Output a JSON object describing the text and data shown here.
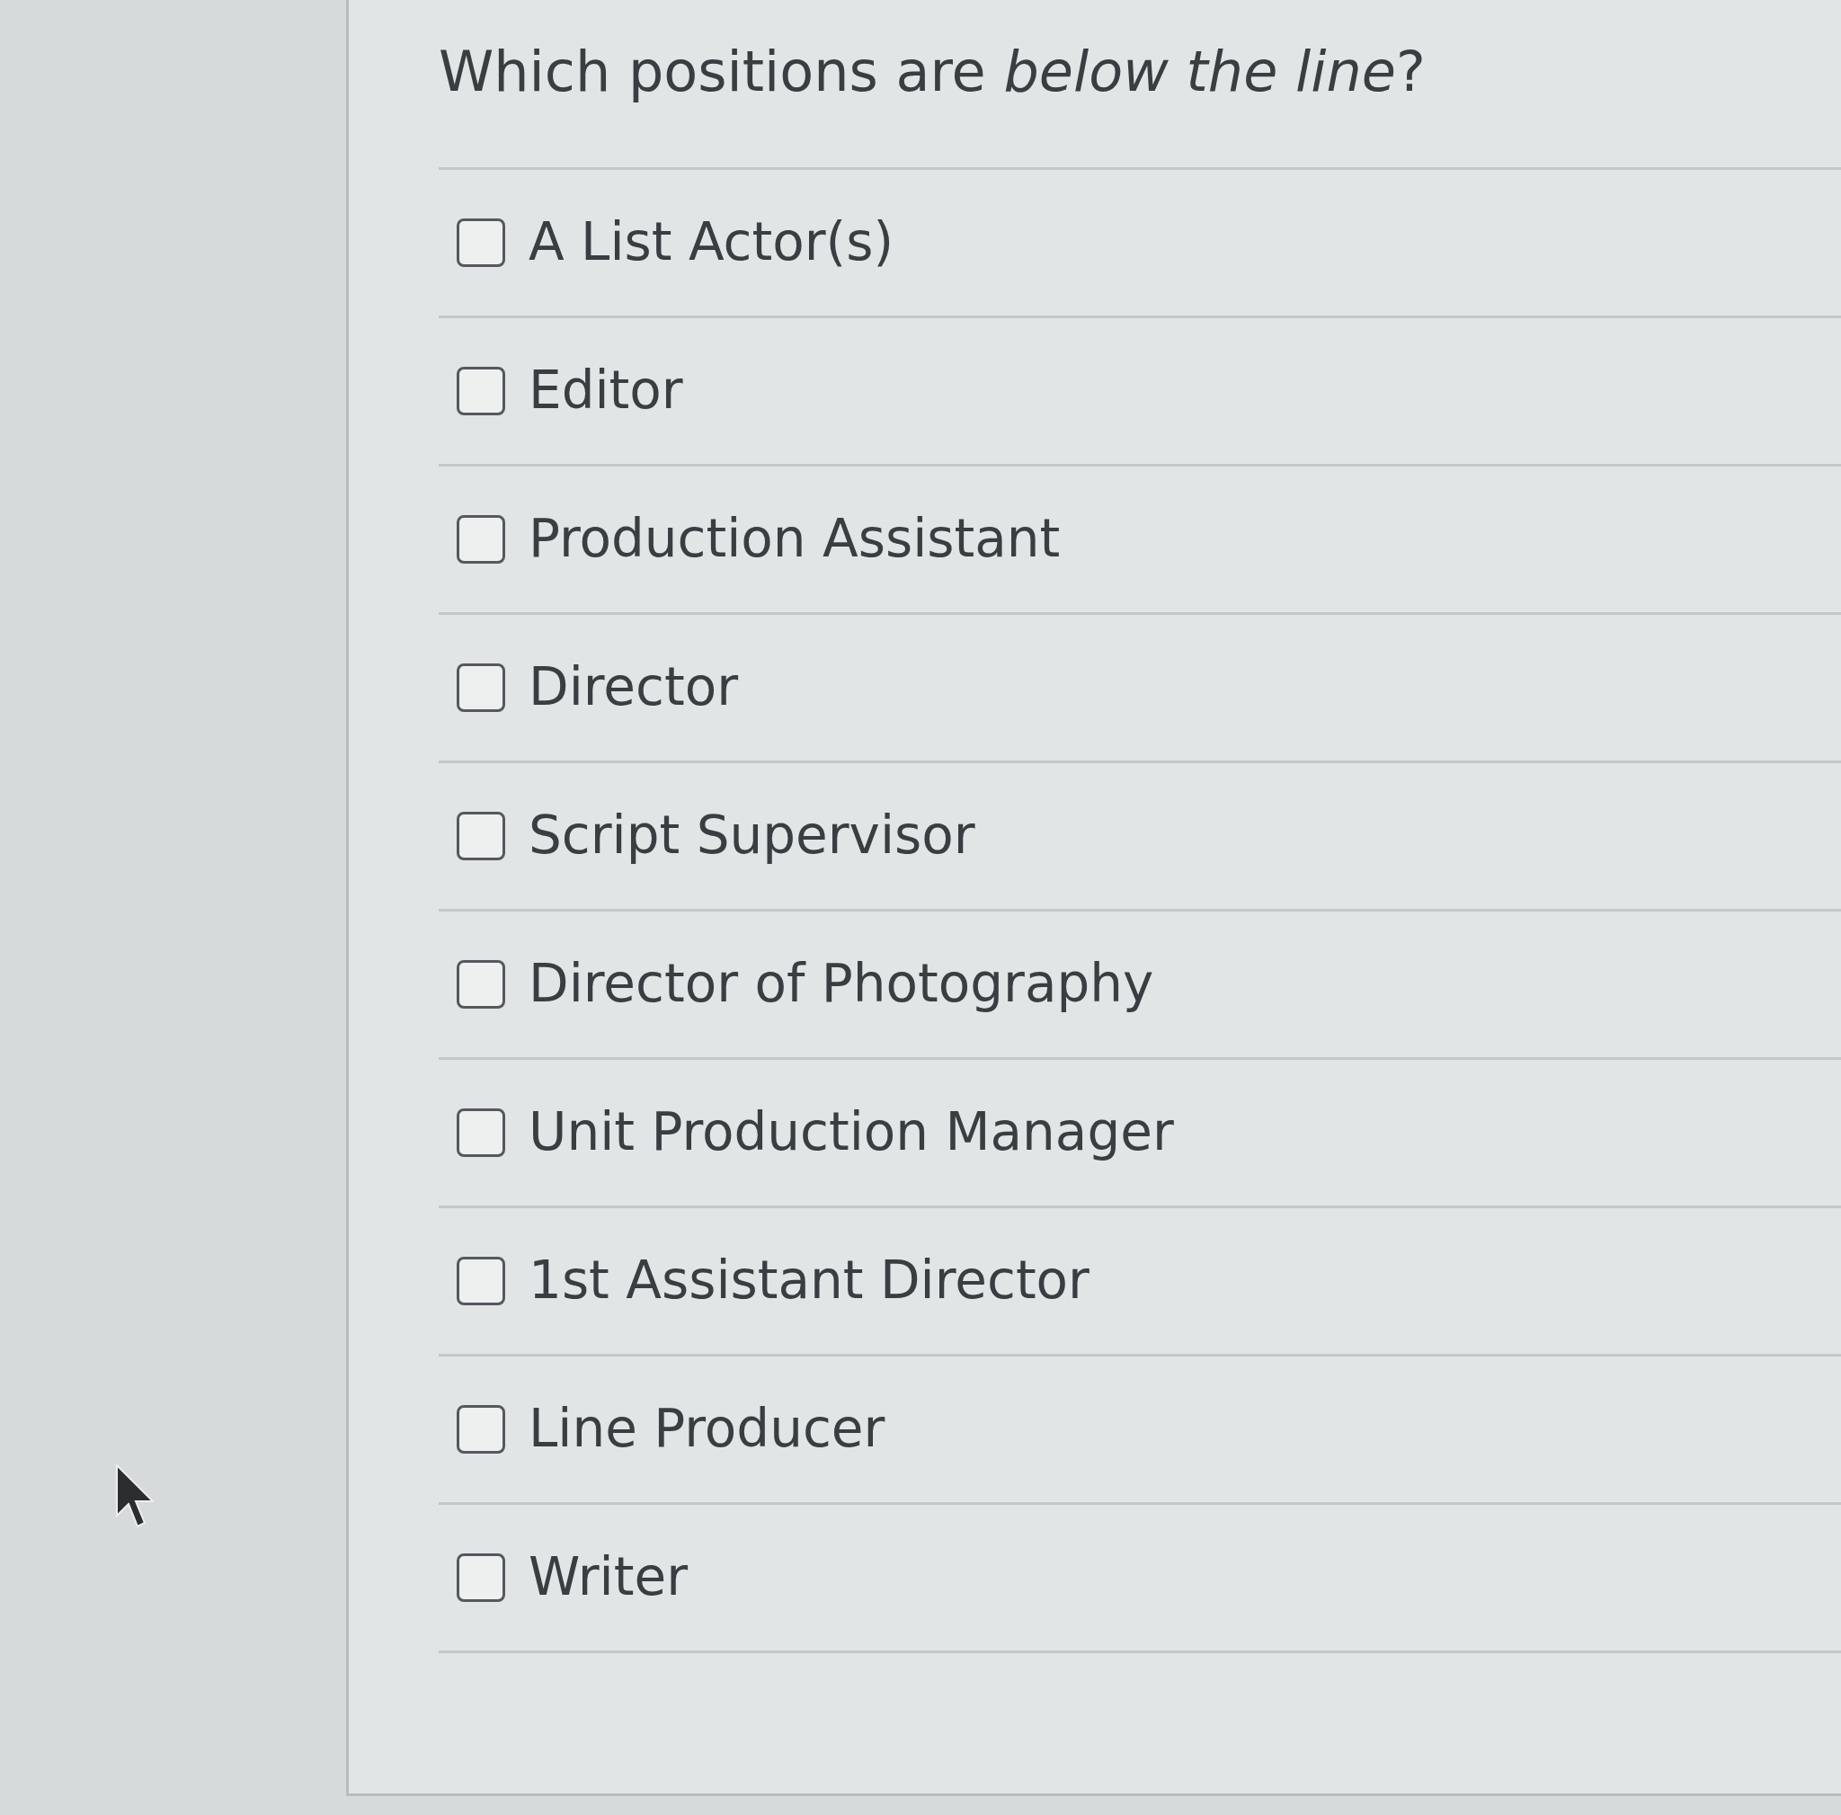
{
  "question": "Which positions are *below the line*?",
  "options": [
    {
      "label": "A List Actor(s)",
      "checked": false
    },
    {
      "label": "Editor",
      "checked": false
    },
    {
      "label": "Production Assistant",
      "checked": false
    },
    {
      "label": "Director",
      "checked": false
    },
    {
      "label": "Script Supervisor",
      "checked": false
    },
    {
      "label": "Director of Photography",
      "checked": false
    },
    {
      "label": "Unit Production Manager",
      "checked": false
    },
    {
      "label": "1st Assistant Director",
      "checked": false
    },
    {
      "label": "Line Producer",
      "checked": false
    },
    {
      "label": "Writer",
      "checked": false
    }
  ]
}
